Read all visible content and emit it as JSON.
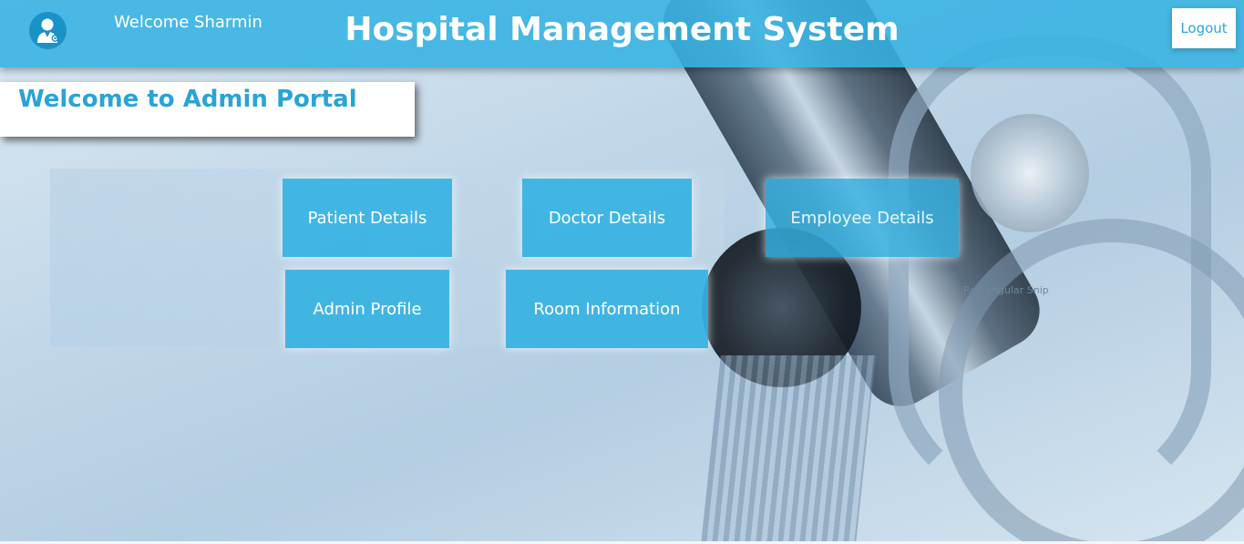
{
  "header": {
    "welcome_text": "Welcome Sharmin",
    "title": "Hospital Management System",
    "logout_label": "Logout",
    "avatar_icon": "doctor-avatar-icon",
    "bg_color": "#36b2e2"
  },
  "portal": {
    "title": "Welcome to Admin Portal"
  },
  "menu": {
    "patient_details": "Patient Details",
    "doctor_details": "Doctor Details",
    "employee_details": "Employee Details",
    "admin_profile": "Admin Profile",
    "room_information": "Room Information"
  },
  "overlay": {
    "snip_label": "Rectangular Snip"
  },
  "colors": {
    "accent": "#36b2e2",
    "portal_text": "#2aa3d8"
  }
}
